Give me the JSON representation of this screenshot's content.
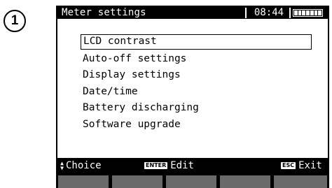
{
  "step_number": "1",
  "header": {
    "title": "Meter settings",
    "time": "08:44",
    "battery_level": 1.0
  },
  "menu": {
    "items": [
      {
        "label": "LCD contrast",
        "selected": true
      },
      {
        "label": "Auto-off settings",
        "selected": false
      },
      {
        "label": "Display settings",
        "selected": false
      },
      {
        "label": "Date/time",
        "selected": false
      },
      {
        "label": "Battery discharging",
        "selected": false
      },
      {
        "label": "Software upgrade",
        "selected": false
      }
    ]
  },
  "footer": {
    "choice_label": "Choice",
    "edit_key": "ENTER",
    "edit_label": "Edit",
    "exit_key": "ESC",
    "exit_label": "Exit"
  },
  "colors": {
    "lcd_background": "#ffffff",
    "bar_background": "#000000",
    "softkey": "#6a6a6a"
  },
  "icons": {
    "choice": "up-down-arrows-icon",
    "battery": "battery-icon"
  }
}
